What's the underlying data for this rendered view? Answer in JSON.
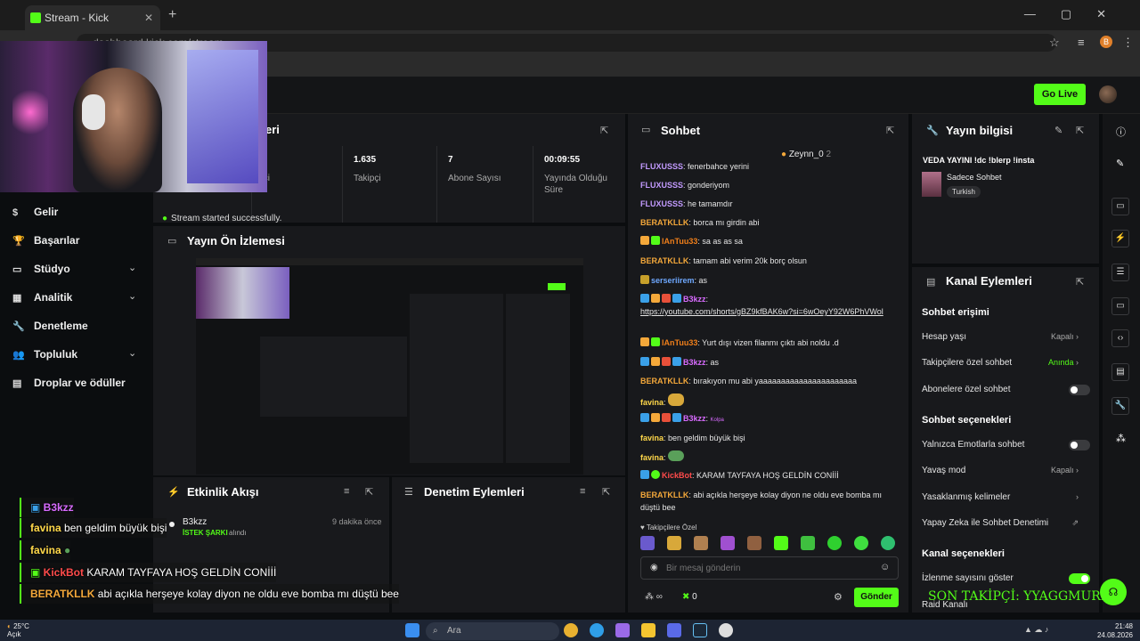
{
  "browser": {
    "tab_title": "Stream - Kick Dashboard",
    "tab_close": "✕",
    "new_tab": "+",
    "window_controls": "—▢✕",
    "url": "dashboard.kick.com/stream",
    "profile_initial": "B"
  },
  "topbar": {
    "go_live": "Go Live"
  },
  "sidebar": {
    "items": [
      {
        "label": "Gelir",
        "icon": "$"
      },
      {
        "label": "Başarılar",
        "icon": "🏆"
      },
      {
        "label": "Stüdyo",
        "icon": "▭",
        "chevron": "⌄"
      },
      {
        "label": "Analitik",
        "icon": "▦",
        "chevron": "⌄"
      },
      {
        "label": "Denetleme",
        "icon": "🔧"
      },
      {
        "label": "Topluluk",
        "icon": "👥",
        "chevron": "⌄"
      },
      {
        "label": "Droplar ve ödüller",
        "icon": "▤"
      }
    ]
  },
  "stats": {
    "title_fragment": "eri",
    "viewer_fragment": "eyici",
    "cells": [
      {
        "value": "1.635",
        "label": "Takipçi"
      },
      {
        "value": "7",
        "label": "Abone Sayısı"
      },
      {
        "value": "00:09:55",
        "label": "Yayında Olduğu Süre"
      }
    ],
    "toast": "Stream started successfully."
  },
  "preview": {
    "title": "Yayın Ön İzlemesi"
  },
  "activity": {
    "title": "Etkinlik Akışı",
    "user": "B3kzz",
    "time": "9 dakika önce",
    "event_tag": "İSTEK ŞARKI",
    "event_text": "alındı"
  },
  "moderation": {
    "title": "Denetim Eylemleri"
  },
  "chat": {
    "title": "Sohbet",
    "pinned_user": "Zeynn_0",
    "pinned_count": "2",
    "messages": [
      {
        "user": "FLUXUSSS",
        "color": "#c39bff",
        "text": ": fenerbahce yerini"
      },
      {
        "user": "FLUXUSSS",
        "color": "#c39bff",
        "text": ": gonderiyom"
      },
      {
        "user": "FLUXUSSS",
        "color": "#c39bff",
        "text": ": he tamamdır"
      },
      {
        "user": "BERATKLLK",
        "color": "#f4a83a",
        "text": ": borca mı girdin abi"
      },
      {
        "user": "lAnTuu33",
        "color": "#f07f1a",
        "text": ": sa as as sa"
      },
      {
        "user": "BERATKLLK",
        "color": "#f4a83a",
        "text": ": tamam abi verim 20k borç olsun"
      },
      {
        "user": "serseriirem",
        "color": "#6ea8ff",
        "text": ": as"
      },
      {
        "user": "B3kzz",
        "color": "#d86bff",
        "text": ":"
      },
      {
        "user": "",
        "color": "#e6e6e6",
        "text": "https://youtube.com/shorts/gBZ9kfBAK6w?si=6wOeyY92W6PhVWol"
      },
      {
        "user": "lAnTuu33",
        "color": "#f07f1a",
        "text": ": Yurt dışı vizen filanmı çıktı abi noldu .d"
      },
      {
        "user": "B3kzz",
        "color": "#d86bff",
        "text": ": as"
      },
      {
        "user": "BERATKLLK",
        "color": "#f4a83a",
        "text": ": bırakıyon mu abi yaaaaaaaaaaaaaaaaaaaaaa"
      },
      {
        "user": "favina",
        "color": "#ffd84a",
        "text": ":"
      },
      {
        "user": "B3kzz",
        "color": "#d86bff",
        "text": ":"
      },
      {
        "user": "favina",
        "color": "#ffd84a",
        "text": ": ben geldim büyük bişi"
      },
      {
        "user": "favina",
        "color": "#ffd84a",
        "text": ":"
      },
      {
        "user": "KickBot",
        "color": "#ff4b4b",
        "text": ": KARAM TAYFAYA HOŞ GELDİN CONİİİ"
      },
      {
        "user": "BERATKLLK",
        "color": "#f4a83a",
        "text": ": abi açıkla herşeye kolay diyon ne oldu eve bomba mı düştü bee"
      }
    ],
    "follower_only": "Takipçilere Özel",
    "input_placeholder": "Bir mesaj gönderin",
    "points": "∞",
    "count": "0",
    "send": "Gönder",
    "kolpa": "Kolpa"
  },
  "info": {
    "title": "Yayın bilgisi",
    "stream_title": "VEDA YAYINI !dc !blerp !insta",
    "category": "Sadece Sohbet",
    "language": "Turkish"
  },
  "actions": {
    "title": "Kanal Eylemleri",
    "sec1": "Sohbet erişimi",
    "rows1": [
      {
        "label": "Hesap yaşı",
        "value": "Kapalı"
      },
      {
        "label": "Takipçilere özel sohbet",
        "value": "Anında"
      },
      {
        "label": "Abonelere özel sohbet",
        "value": ""
      }
    ],
    "sec2": "Sohbet seçenekleri",
    "rows2": [
      {
        "label": "Yalnızca Emotlarla sohbet",
        "value": ""
      },
      {
        "label": "Yavaş mod",
        "value": "Kapalı"
      },
      {
        "label": "Yasaklanmış kelimeler",
        "value": ""
      },
      {
        "label": "Yapay Zeka ile Sohbet Denetimi",
        "value": ""
      }
    ],
    "sec3": "Kanal seçenekleri",
    "rows3": [
      {
        "label": "İzlenme sayısını göster",
        "value": ""
      },
      {
        "label": "Raid Kanalı",
        "value": ""
      }
    ]
  },
  "overlay": {
    "lines": [
      {
        "user": "B3kzz",
        "color": "#d86bff",
        "text": ""
      },
      {
        "user": "favina",
        "color": "#ffd84a",
        "text": " ben geldim büyük bişi"
      },
      {
        "user": "favina",
        "color": "#ffd84a",
        "text": ""
      },
      {
        "user": "KickBot",
        "color": "#ff4b4b",
        "text": " KARAM TAYFAYA HOŞ GELDİN CONİİİ"
      },
      {
        "user": "BERATKLLK",
        "color": "#f4a83a",
        "text": " abi açıkla herşeye kolay diyon ne oldu eve bomba mı düştü bee"
      }
    ],
    "new_follower": "SON TAKİPÇİ: YYAGGMURR36"
  },
  "taskbar": {
    "temp": "25°C",
    "weather": "Açık",
    "search": "Ara",
    "time": "21:48",
    "date": "24.08.2026"
  },
  "colors": {
    "accent": "#53fc18"
  }
}
